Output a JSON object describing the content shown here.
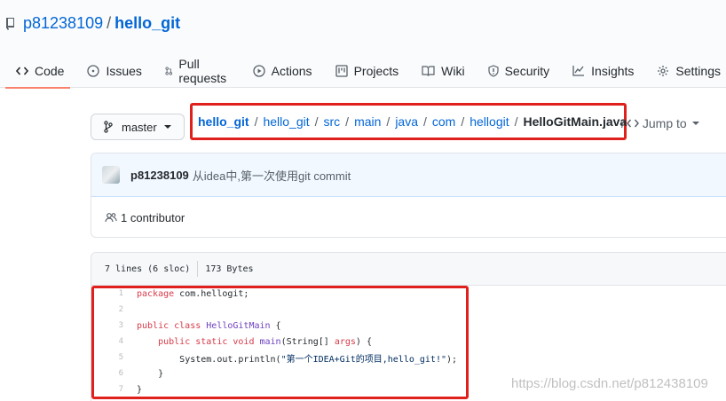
{
  "repo": {
    "owner": "p81238109",
    "separator": "/",
    "name": "hello_git"
  },
  "tabs": [
    {
      "label": "Code",
      "icon": "code-icon",
      "selected": true
    },
    {
      "label": "Issues",
      "icon": "issue-icon"
    },
    {
      "label": "Pull requests",
      "icon": "pull-request-icon"
    },
    {
      "label": "Actions",
      "icon": "play-icon"
    },
    {
      "label": "Projects",
      "icon": "project-icon"
    },
    {
      "label": "Wiki",
      "icon": "book-icon"
    },
    {
      "label": "Security",
      "icon": "shield-icon"
    },
    {
      "label": "Insights",
      "icon": "graph-icon"
    },
    {
      "label": "Settings",
      "icon": "gear-icon"
    }
  ],
  "branch": {
    "label": "master",
    "icon": "branch-icon"
  },
  "breadcrumb": {
    "items": [
      "hello_git",
      "hello_git",
      "src",
      "main",
      "java",
      "com",
      "hellogit"
    ],
    "separator": "/",
    "file": "HelloGitMain.java"
  },
  "jump": {
    "separator": "/",
    "label": "Jump to"
  },
  "commit": {
    "author": "p81238109",
    "message": "从idea中,第一次使用git commit"
  },
  "contributors": {
    "label": "1 contributor",
    "icon": "people-icon"
  },
  "file": {
    "lines_info": "7 lines (6 sloc)",
    "size": "173 Bytes"
  },
  "code": {
    "line_numbers": [
      "1",
      "2",
      "3",
      "4",
      "5",
      "6",
      "7"
    ],
    "tokens": {
      "l1_kw": "package",
      "l1_rest": " com.hellogit;",
      "l3_kw": "public class",
      "l3_sp": " ",
      "l3_name": "HelloGitMain",
      "l3_rest": " {",
      "l4_indent": "    ",
      "l4_kw": "public static void",
      "l4_sp": " ",
      "l4_fn": "main",
      "l4_open": "(String[] ",
      "l4_arg": "args",
      "l4_close": ") {",
      "l5_indent": "        ",
      "l5_call": "System.out.println(",
      "l5_str": "\"第一个IDEA+Git的项目,hello_git!\"",
      "l5_end": ");",
      "l6_indent": "    ",
      "l6_brace": "}",
      "l7_brace": "}"
    }
  },
  "watermark": "https://blog.csdn.net/p812438109",
  "colors": {
    "link": "#0366d6",
    "highlight_border": "#e0201c",
    "keyword": "#d73a49",
    "function": "#6f42c1",
    "string": "#032f62"
  }
}
